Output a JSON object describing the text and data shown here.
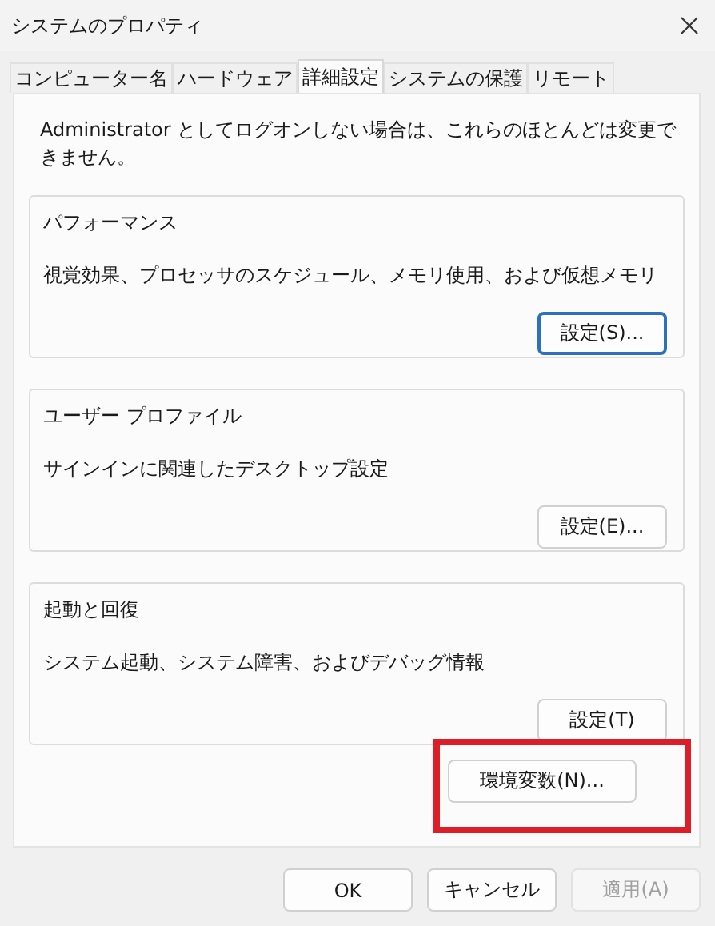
{
  "window": {
    "title": "システムのプロパティ"
  },
  "tabs": [
    {
      "label": "コンピューター名",
      "selected": false
    },
    {
      "label": "ハードウェア",
      "selected": false
    },
    {
      "label": "詳細設定",
      "selected": true
    },
    {
      "label": "システムの保護",
      "selected": false
    },
    {
      "label": "リモート",
      "selected": false
    }
  ],
  "notice": "Administrator としてログオンしない場合は、これらのほとんどは変更できません。",
  "groups": [
    {
      "title": "パフォーマンス",
      "description": "視覚効果、プロセッサのスケジュール、メモリ使用、および仮想メモリ",
      "button": {
        "label": "設定(S)...",
        "focused": true
      }
    },
    {
      "title": "ユーザー プロファイル",
      "description": "サインインに関連したデスクトップ設定",
      "button": {
        "label": "設定(E)...",
        "focused": false
      }
    },
    {
      "title": "起動と回復",
      "description": "システム起動、システム障害、およびデバッグ情報",
      "button": {
        "label": "設定(T)",
        "focused": false
      }
    }
  ],
  "environment_button": {
    "label": "環境変数(N)...",
    "highlighted": true
  },
  "buttons": [
    {
      "label": "OK",
      "disabled": false
    },
    {
      "label": "キャンセル",
      "disabled": false
    },
    {
      "label": "適用(A)",
      "disabled": true
    }
  ]
}
